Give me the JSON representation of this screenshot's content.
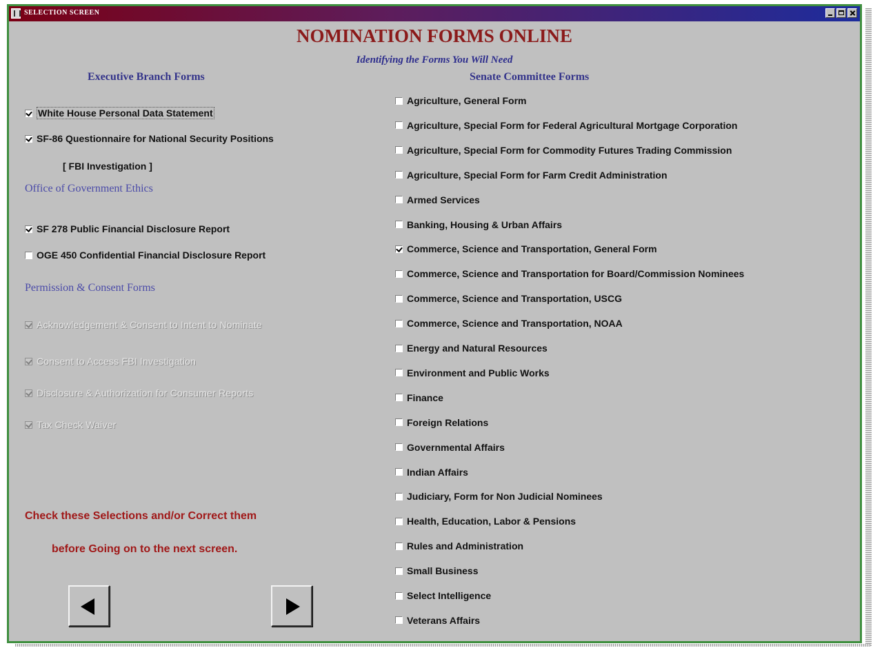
{
  "window": {
    "title": "SELECTION SCREEN"
  },
  "header": {
    "title": "NOMINATION FORMS ONLINE",
    "subtitle": "Identifying the Forms You Will Need"
  },
  "executive": {
    "heading": "Executive Branch Forms",
    "items": [
      {
        "label": "White House Personal Data Statement",
        "checked": true
      },
      {
        "label": "SF-86 Questionnaire for National Security Positions",
        "checked": true
      }
    ],
    "fbi_note": "[ FBI Investigation ]"
  },
  "ethics": {
    "heading": "Office of Government Ethics",
    "items": [
      {
        "label": "SF 278 Public Financial Disclosure Report",
        "checked": true
      },
      {
        "label": "OGE 450 Confidential Financial Disclosure Report",
        "checked": false
      }
    ]
  },
  "permission": {
    "heading": "Permission & Consent Forms",
    "items": [
      {
        "label": "Acknowledgement & Consent to Intent to Nominate",
        "checked": true,
        "disabled": true
      },
      {
        "label": "Consent to Access FBI Investigation",
        "checked": true,
        "disabled": true
      },
      {
        "label": "Disclosure & Authorization for Consumer Reports",
        "checked": true,
        "disabled": true
      },
      {
        "label": "Tax Check Waiver",
        "checked": true,
        "disabled": true
      }
    ]
  },
  "instructions": {
    "line1": "Check these Selections and/or Correct them",
    "line2": "before Going on to the next screen."
  },
  "navigation": {
    "back_icon": "left-arrow-icon",
    "next_icon": "right-arrow-icon"
  },
  "senate": {
    "heading": "Senate Committee Forms",
    "items": [
      {
        "label": "Agriculture, General Form",
        "checked": false
      },
      {
        "label": "Agriculture, Special Form for Federal Agricultural Mortgage Corporation",
        "checked": false
      },
      {
        "label": "Agriculture, Special Form for Commodity Futures Trading Commission",
        "checked": false
      },
      {
        "label": "Agriculture, Special Form for Farm Credit Administration",
        "checked": false
      },
      {
        "label": "Armed Services",
        "checked": false
      },
      {
        "label": "Banking, Housing & Urban Affairs",
        "checked": false
      },
      {
        "label": "Commerce, Science and Transportation, General Form",
        "checked": true
      },
      {
        "label": "Commerce, Science and Transportation for Board/Commission Nominees",
        "checked": false
      },
      {
        "label": "Commerce, Science and Transportation, USCG",
        "checked": false
      },
      {
        "label": "Commerce, Science and Transportation, NOAA",
        "checked": false
      },
      {
        "label": "Energy and Natural Resources",
        "checked": false
      },
      {
        "label": "Environment and Public Works",
        "checked": false
      },
      {
        "label": "Finance",
        "checked": false
      },
      {
        "label": "Foreign Relations",
        "checked": false
      },
      {
        "label": "Governmental Affairs",
        "checked": false
      },
      {
        "label": "Indian Affairs",
        "checked": false
      },
      {
        "label": "Judiciary, Form for Non Judicial Nominees",
        "checked": false
      },
      {
        "label": "Health, Education, Labor & Pensions",
        "checked": false
      },
      {
        "label": "Rules and Administration",
        "checked": false
      },
      {
        "label": "Small Business",
        "checked": false
      },
      {
        "label": "Select Intelligence",
        "checked": false
      },
      {
        "label": "Veterans Affairs",
        "checked": false
      }
    ]
  },
  "colors": {
    "title_red": "#8b1a1a",
    "heading_blue": "#33338a",
    "note_red": "#a01818",
    "window_gray": "#c0c0c0"
  }
}
